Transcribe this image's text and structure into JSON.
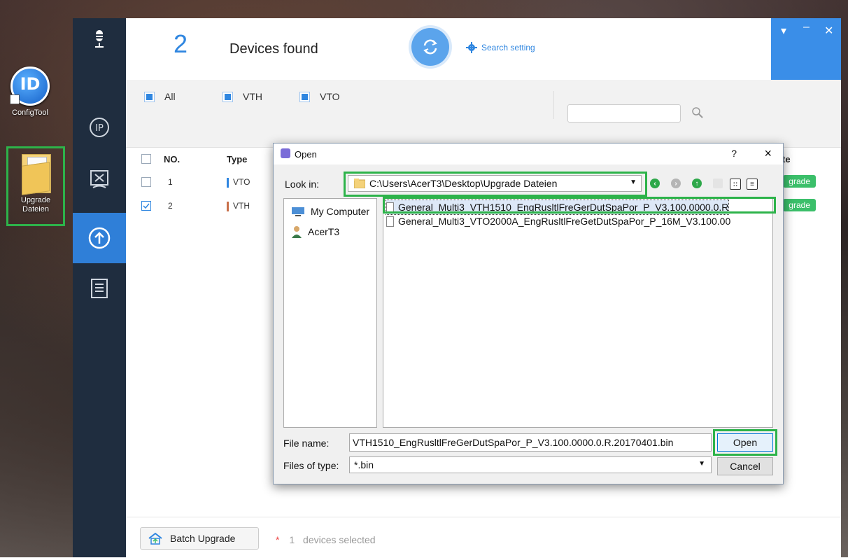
{
  "desktop": {
    "icons": [
      {
        "label": "ConfigTool"
      },
      {
        "label_line1": "Upgrade",
        "label_line2": "Dateien"
      }
    ]
  },
  "header": {
    "device_count": "2",
    "devices_found_label": "Devices found",
    "search_setting_label": "Search setting"
  },
  "filters": {
    "all_label": "All",
    "vth_label": "VTH",
    "vto_label": "VTO",
    "search_value": ""
  },
  "table": {
    "headers": {
      "no": "NO.",
      "type": "Type",
      "upgrade_partial": "te"
    },
    "rows": [
      {
        "no": "1",
        "type": "VTO",
        "checked": false,
        "type_color": "#2f86e0",
        "action": "grade"
      },
      {
        "no": "2",
        "type": "VTH",
        "checked": true,
        "type_color": "#c8704a",
        "action": "grade"
      }
    ]
  },
  "footer": {
    "batch_upgrade_label": "Batch Upgrade",
    "star": "*",
    "selected_count": "1",
    "selected_suffix": "devices selected"
  },
  "dialog": {
    "title": "Open",
    "help": "?",
    "close": "×",
    "look_in_label": "Look in:",
    "look_in_path": "C:\\Users\\AcerT3\\Desktop\\Upgrade Dateien",
    "places": [
      {
        "label": "My Computer",
        "icon": "computer-icon"
      },
      {
        "label": "AcerT3",
        "icon": "user-icon"
      }
    ],
    "files": [
      {
        "name": "General_Multi3_VTH1510_EngRusltlFreGerDutSpaPor_P_V3.100.0000.0.R",
        "selected": true
      },
      {
        "name": "General_Multi3_VTO2000A_EngRusltlFreGetDutSpaPor_P_16M_V3.100.00",
        "selected": false
      }
    ],
    "file_name_label": "File name:",
    "file_name_value": "VTH1510_EngRusltlFreGerDutSpaPor_P_V3.100.0000.0.R.20170401.bin",
    "files_of_type_label": "Files of type:",
    "files_of_type_value": "*.bin",
    "open_button": "Open",
    "cancel_button": "Cancel"
  },
  "colors": {
    "accent": "#2f86e0",
    "sidebar": "#1f2d3f",
    "highlight_outline": "#2db34a",
    "upgrade_button": "#3bbf6a"
  }
}
